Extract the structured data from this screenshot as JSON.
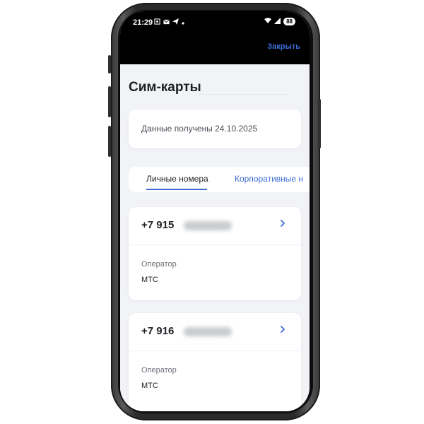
{
  "status_bar": {
    "time": "21:29",
    "left_icons": [
      "screenshot-icon",
      "mail-icon",
      "telegram-icon",
      "dot-icon"
    ],
    "right_icons": [
      "wifi-icon",
      "signal-icon"
    ],
    "battery": "88"
  },
  "header": {
    "close_label": "Закрыть"
  },
  "page": {
    "title": "Сим-карты",
    "info": "Данные получены 24.10.2025"
  },
  "tabs": [
    {
      "label": "Личные номера",
      "active": true
    },
    {
      "label": "Корпоративные н",
      "active": false
    }
  ],
  "sim_cards": [
    {
      "number_prefix": "+7 915",
      "operator_label": "Оператор",
      "operator": "МТС"
    },
    {
      "number_prefix": "+7 916",
      "operator_label": "Оператор",
      "operator": "МТС"
    }
  ],
  "colors": {
    "accent": "#3d6dd8",
    "background": "#f2f3f7",
    "card": "#ffffff"
  }
}
